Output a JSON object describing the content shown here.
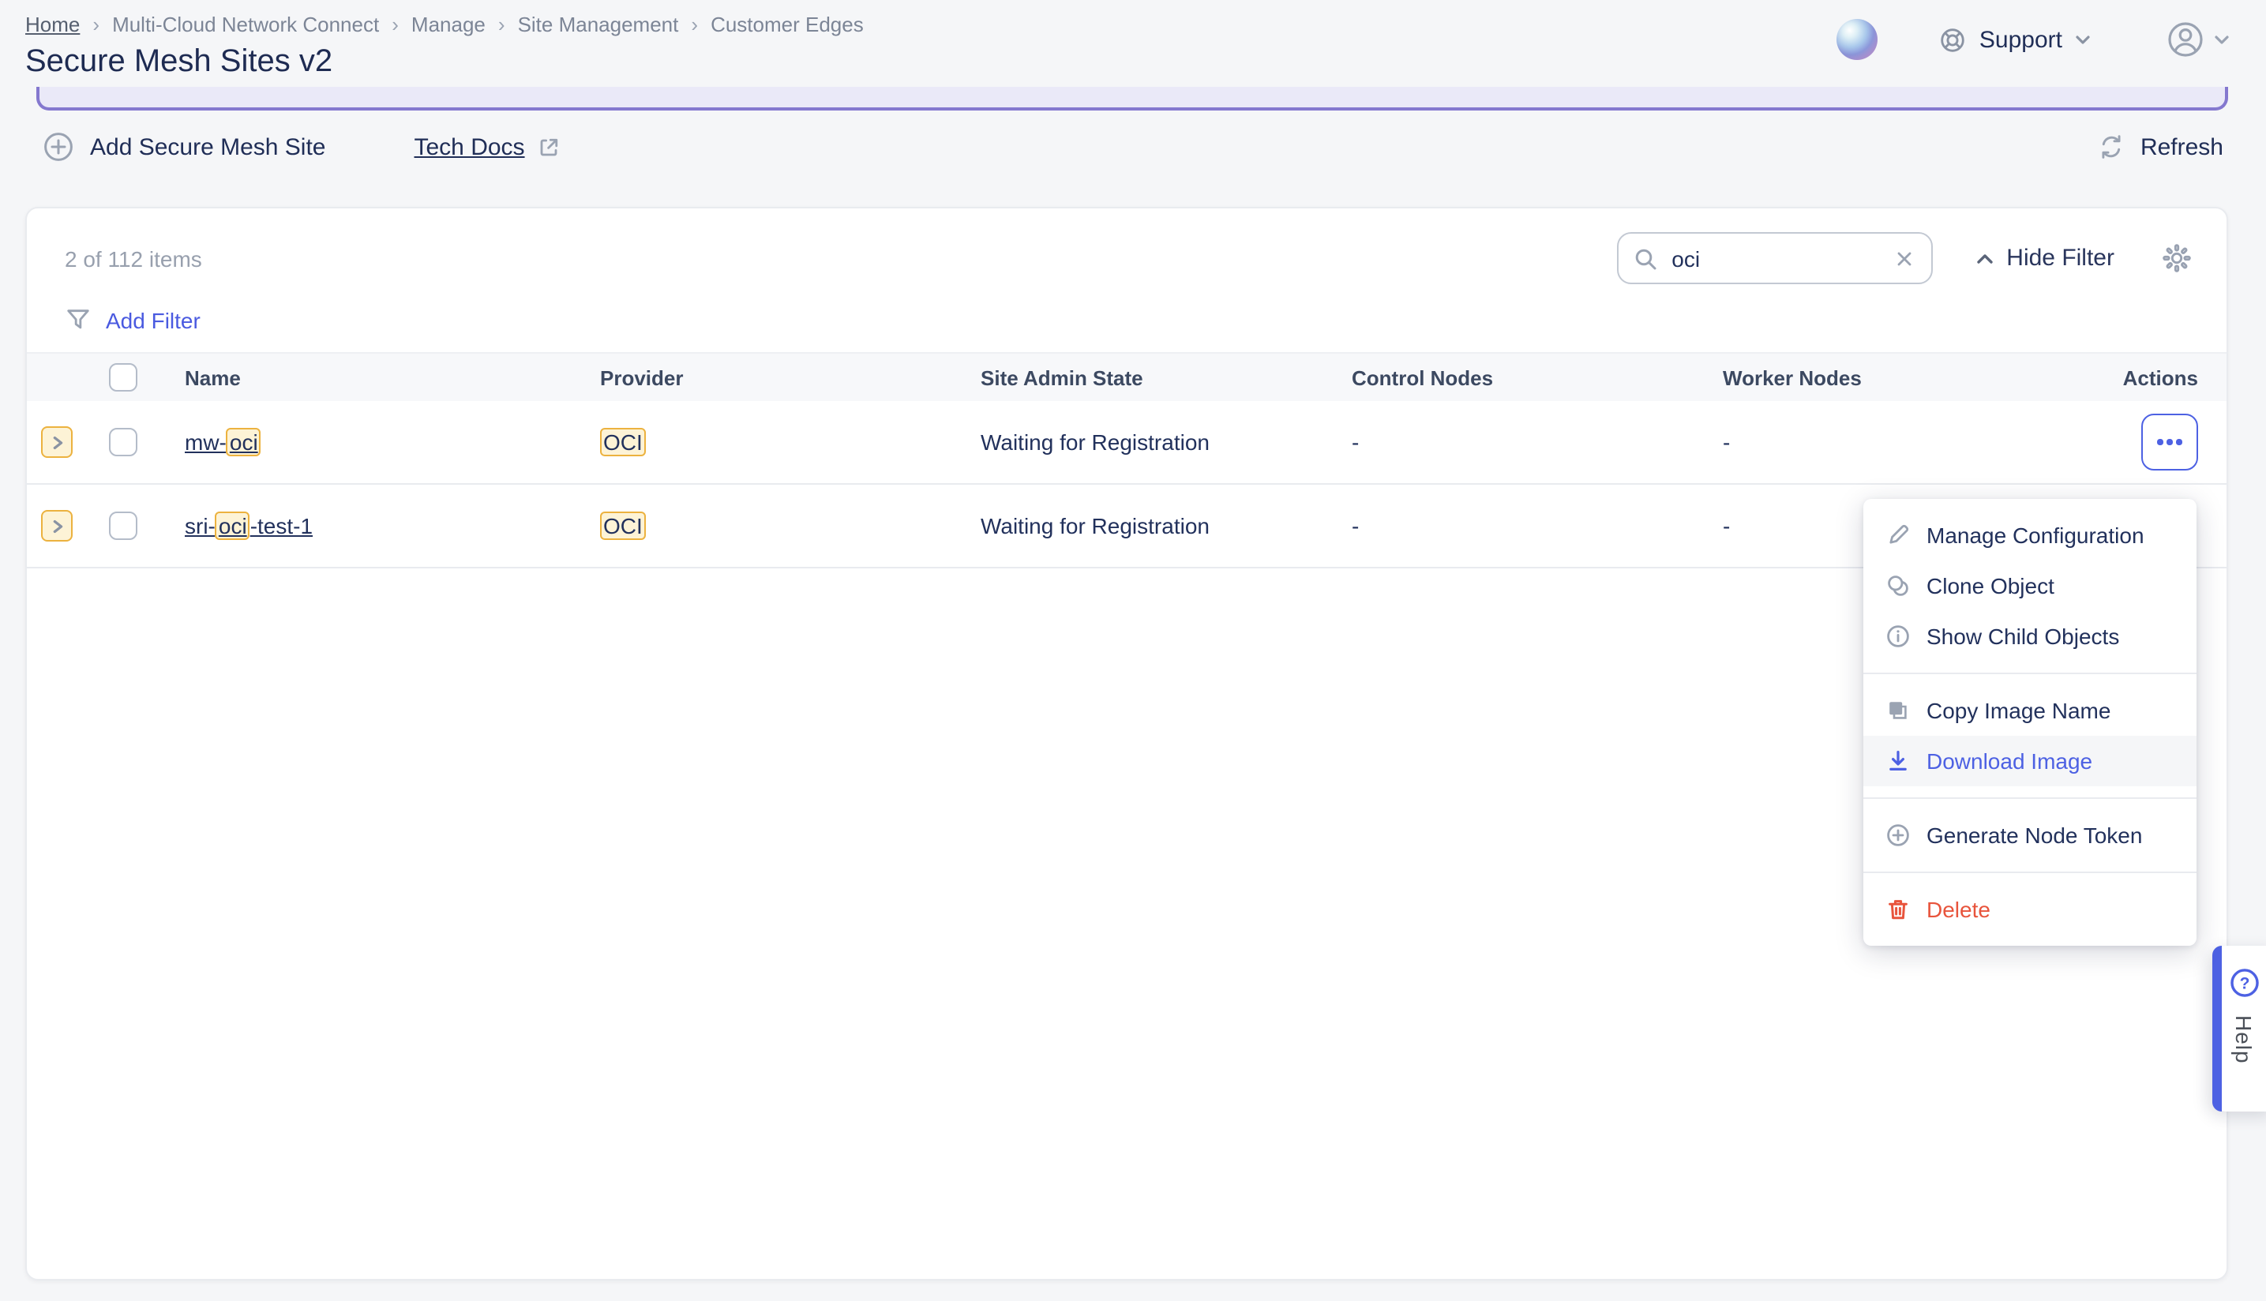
{
  "breadcrumb": {
    "items": [
      "Home",
      "Multi-Cloud Network Connect",
      "Manage",
      "Site Management",
      "Customer Edges"
    ]
  },
  "page": {
    "title": "Secure Mesh Sites v2"
  },
  "header": {
    "support_label": "Support"
  },
  "toolbar": {
    "add_button": "Add Secure Mesh Site",
    "tech_docs": "Tech Docs",
    "refresh": "Refresh"
  },
  "table_panel": {
    "items_count": "2 of 112 items",
    "search_value": "oci",
    "hide_filter": "Hide Filter",
    "add_filter": "Add Filter",
    "columns": [
      "Name",
      "Provider",
      "Site Admin State",
      "Control Nodes",
      "Worker Nodes",
      "Actions"
    ],
    "rows": [
      {
        "name_pre": "mw-",
        "name_match": "oci",
        "name_post": "",
        "provider": "OCI",
        "site_admin_state": "Waiting for Registration",
        "control_nodes": "-",
        "worker_nodes": "-"
      },
      {
        "name_pre": "sri-",
        "name_match": "oci",
        "name_post": "-test-1",
        "provider": "OCI",
        "site_admin_state": "Waiting for Registration",
        "control_nodes": "-",
        "worker_nodes": "-"
      }
    ]
  },
  "context_menu": {
    "sections": [
      {
        "items": [
          {
            "label": "Manage Configuration",
            "icon": "pencil-icon"
          },
          {
            "label": "Clone Object",
            "icon": "clone-icon"
          },
          {
            "label": "Show Child Objects",
            "icon": "info-icon"
          }
        ]
      },
      {
        "items": [
          {
            "label": "Copy Image Name",
            "icon": "copy-icon"
          },
          {
            "label": "Download Image",
            "icon": "download-icon",
            "highlighted": true
          }
        ]
      },
      {
        "items": [
          {
            "label": "Generate Node Token",
            "icon": "plus-circle-icon"
          }
        ]
      },
      {
        "items": [
          {
            "label": "Delete",
            "icon": "trash-icon",
            "danger": true
          }
        ]
      }
    ]
  },
  "help_tab": {
    "label": "Help"
  },
  "colors": {
    "accent_blue": "#4d61e3",
    "danger_red": "#e8543c",
    "highlight_yellow_bg": "#fdf3d6",
    "highlight_yellow_border": "#ecb23f",
    "banner_purple": "#8478cf",
    "page_bg": "#f5f6f8",
    "text_navy": "#22315c"
  }
}
